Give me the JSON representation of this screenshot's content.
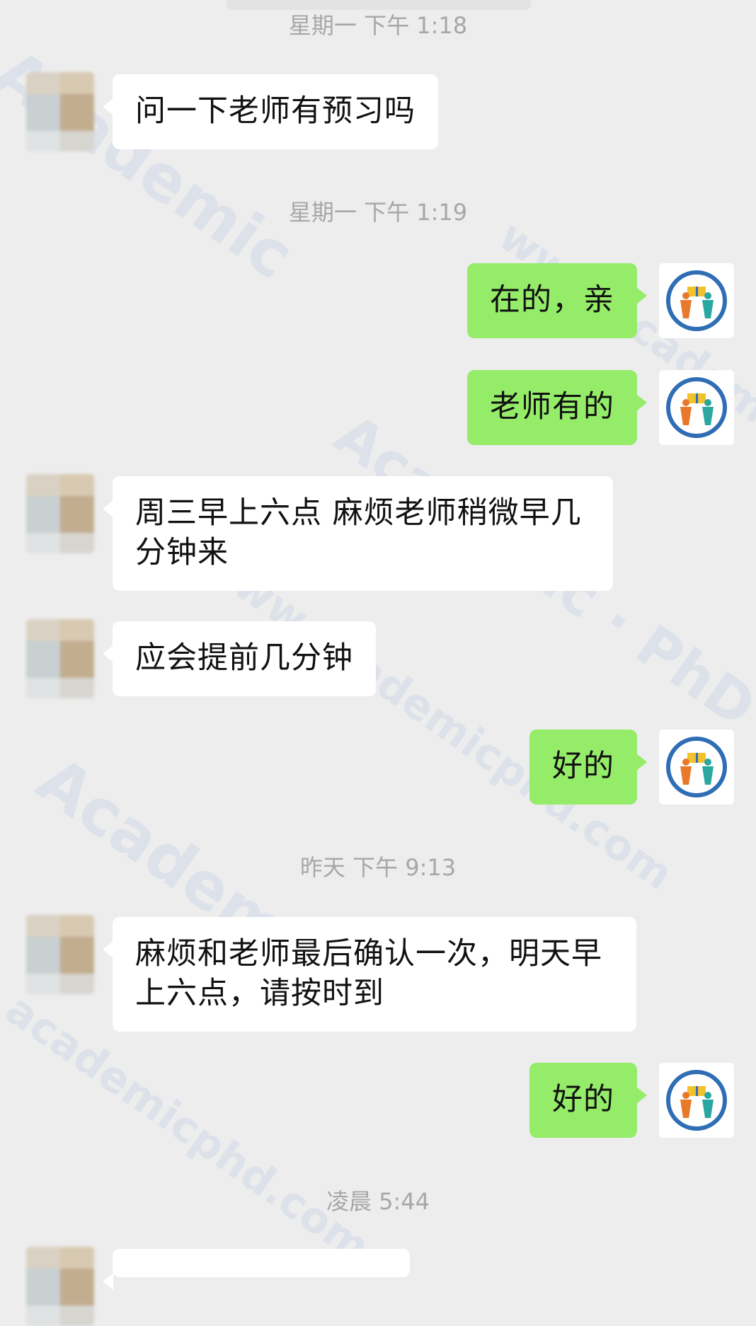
{
  "watermarks": [
    "Academic",
    "Academic",
    "www.academicphd.com",
    "www.academicphd.com",
    "Academic · PhD",
    "academicphd.com"
  ],
  "timestamps": {
    "t0": "星期一 下午 1:18",
    "t1": "星期一 下午 1:19",
    "t2": "昨天 下午 9:13",
    "t3": "凌晨 5:44"
  },
  "messages": {
    "m1": "问一下老师有预习吗",
    "m2": "在的，亲",
    "m3": "老师有的",
    "m4_line1": "周三早上六点 麻烦老师稍微早几",
    "m4_line2": "分钟来",
    "m5": "应会提前几分钟",
    "m6": "好的",
    "m7_line1": "麻烦和老师最后确认一次，明天早",
    "m7_line2": "上六点，请按时到",
    "m8": "好的"
  },
  "colors": {
    "background": "#ededed",
    "incoming_bubble": "#ffffff",
    "outgoing_bubble": "#95ec69",
    "timestamp_text": "#a7a7a7",
    "logo_ring": "#2f6db5",
    "logo_orange": "#e8782a",
    "logo_teal": "#2aa7a0",
    "logo_yellow": "#f2c12e"
  },
  "icons": {
    "contact_avatar": "blurred-avatar",
    "self_avatar": "academic-logo-icon"
  }
}
